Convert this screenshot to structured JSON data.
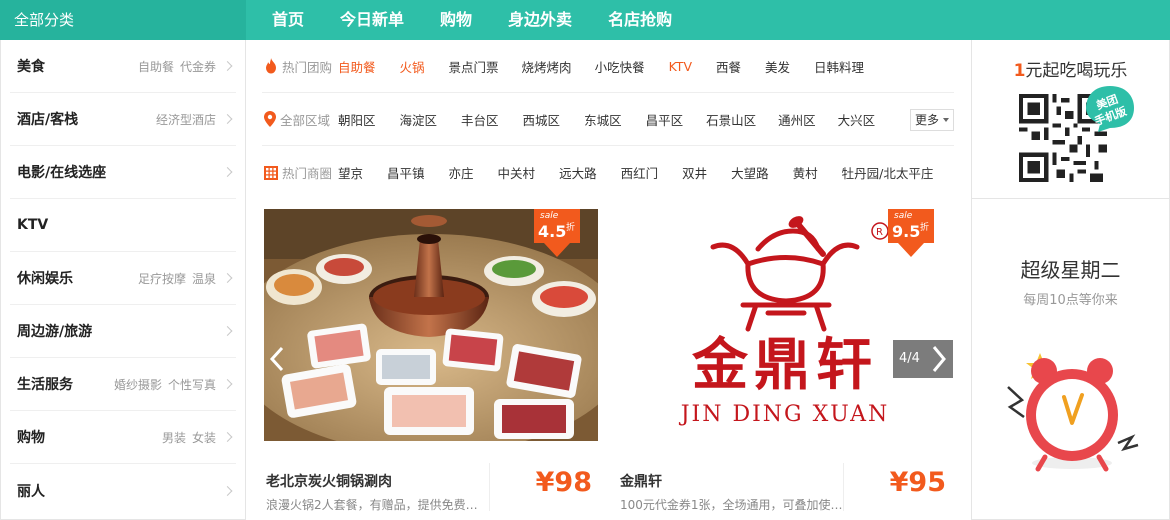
{
  "topnav": {
    "all_categories": "全部分类",
    "items": [
      "首页",
      "今日新单",
      "购物",
      "身边外卖",
      "名店抢购"
    ]
  },
  "sidebar": {
    "items": [
      {
        "title": "美食",
        "subs": [
          "自助餐",
          "代金券"
        ]
      },
      {
        "title": "酒店/客栈",
        "subs": [
          "经济型酒店"
        ]
      },
      {
        "title": "电影/在线选座",
        "subs": []
      },
      {
        "title": "KTV",
        "subs": []
      },
      {
        "title": "休闲娱乐",
        "subs": [
          "足疗按摩",
          "温泉"
        ]
      },
      {
        "title": "周边游/旅游",
        "subs": []
      },
      {
        "title": "生活服务",
        "subs": [
          "婚纱摄影",
          "个性写真"
        ]
      },
      {
        "title": "购物",
        "subs": [
          "男装",
          "女装"
        ]
      },
      {
        "title": "丽人",
        "subs": []
      }
    ]
  },
  "filters": {
    "hot_groupbuy": {
      "label": "热门团购",
      "options": [
        "自助餐",
        "火锅",
        "景点门票",
        "烧烤烤肉",
        "小吃快餐",
        "KTV",
        "西餐",
        "美发",
        "日韩料理"
      ]
    },
    "all_areas": {
      "label": "全部区域",
      "options": [
        "朝阳区",
        "海淀区",
        "丰台区",
        "西城区",
        "东城区",
        "昌平区",
        "石景山区",
        "通州区",
        "大兴区"
      ],
      "more": "更多"
    },
    "hot_districts": {
      "label": "热门商圈",
      "options": [
        "望京",
        "昌平镇",
        "亦庄",
        "中关村",
        "远大路",
        "西红门",
        "双井",
        "大望路",
        "黄村",
        "牡丹园/北太平庄"
      ]
    }
  },
  "deals": [
    {
      "title": "老北京炭火铜锅涮肉",
      "desc": "浪漫火锅2人套餐，有赠品，提供免费…",
      "price": "¥98",
      "sale_label": "sale",
      "discount": "4.5",
      "discount_unit": "折"
    },
    {
      "title": "金鼎轩",
      "desc": "100元代金券1张，全场通用，可叠加使…",
      "price": "¥95",
      "sale_label": "sale",
      "discount": "9.5",
      "discount_unit": "折",
      "logo_text": "金鼎轩",
      "logo_pinyin": "JIN DING XUAN"
    }
  ],
  "carousel": {
    "pager": "4/4"
  },
  "promo": {
    "headline_num": "1",
    "headline_rest": "元起吃喝玩乐",
    "app_badge": [
      "美团",
      "手机版"
    ],
    "super_title": "超级星期二",
    "super_sub": "每周10点等你来"
  },
  "colors": {
    "brand": "#2ebfa8",
    "accent": "#f25a1d"
  }
}
